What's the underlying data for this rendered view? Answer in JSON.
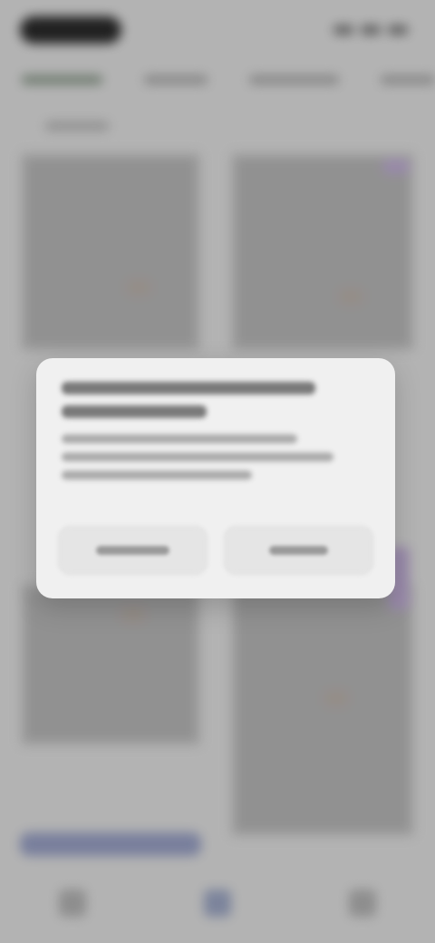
{
  "ui": {
    "overlay_state": "modal-dialog",
    "colors": {
      "background": "#d3d3d3",
      "dialog_background": "#f0f0f0",
      "accent_nav": "#8f99b6",
      "accent_badge": "#b3a0c8",
      "bottom_cta": "#8b93b7"
    }
  },
  "dialog": {
    "title": "",
    "message": "",
    "primary_button_label": "",
    "secondary_button_label": ""
  }
}
